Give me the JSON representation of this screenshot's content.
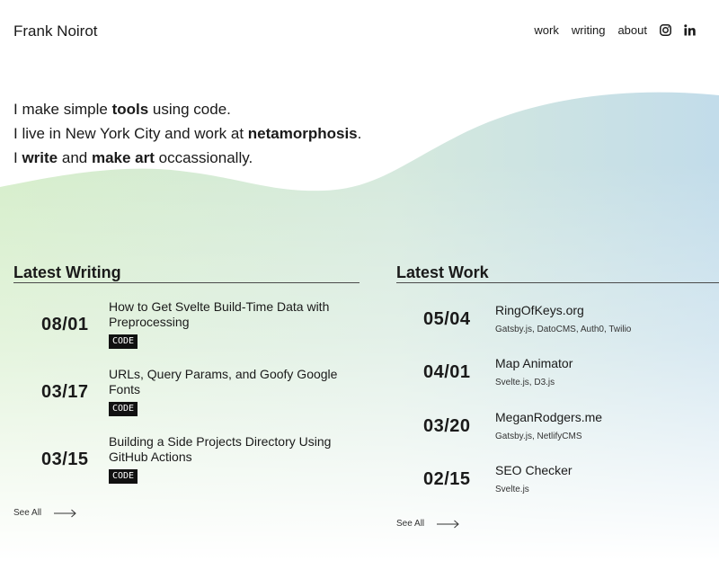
{
  "site": {
    "name": "Frank Noirot"
  },
  "nav": {
    "items": [
      {
        "label": "work"
      },
      {
        "label": "writing"
      },
      {
        "label": "about"
      }
    ],
    "icons": [
      "instagram-icon",
      "linkedin-icon"
    ]
  },
  "hero": {
    "line1": {
      "pre": "I make simple ",
      "bold": "tools",
      "post": " using code."
    },
    "line2": {
      "pre": "I live in New York City and work at ",
      "bold": "netamorphosis",
      "post": "."
    },
    "line3": {
      "pre": "I ",
      "bold1": "write",
      "mid": " and ",
      "bold2": "make art",
      "post": " occassionally."
    }
  },
  "writing": {
    "heading": "Latest Writing",
    "items": [
      {
        "date": "08/01",
        "title": "How to Get Svelte Build-Time Data with Preprocessing",
        "tag": "CODE"
      },
      {
        "date": "03/17",
        "title": "URLs, Query Params, and Goofy Google Fonts",
        "tag": "CODE"
      },
      {
        "date": "03/15",
        "title": "Building a Side Projects Directory Using GitHub Actions",
        "tag": "CODE"
      }
    ],
    "see_all": "See All"
  },
  "work": {
    "heading": "Latest Work",
    "items": [
      {
        "date": "05/04",
        "title": "RingOfKeys.org",
        "tech": "Gatsby.js, DatoCMS, Auth0, Twilio"
      },
      {
        "date": "04/01",
        "title": "Map Animator",
        "tech": "Svelte.js, D3.js"
      },
      {
        "date": "03/20",
        "title": "MeganRodgers.me",
        "tech": "Gatsby.js, NetlifyCMS"
      },
      {
        "date": "02/15",
        "title": "SEO Checker",
        "tech": "Svelte.js"
      }
    ],
    "see_all": "See All"
  },
  "colors": {
    "gradient_green": "#d4ecc8",
    "gradient_blue": "#c5deea",
    "text": "#1a1a1a",
    "tag_bg": "#111111"
  }
}
